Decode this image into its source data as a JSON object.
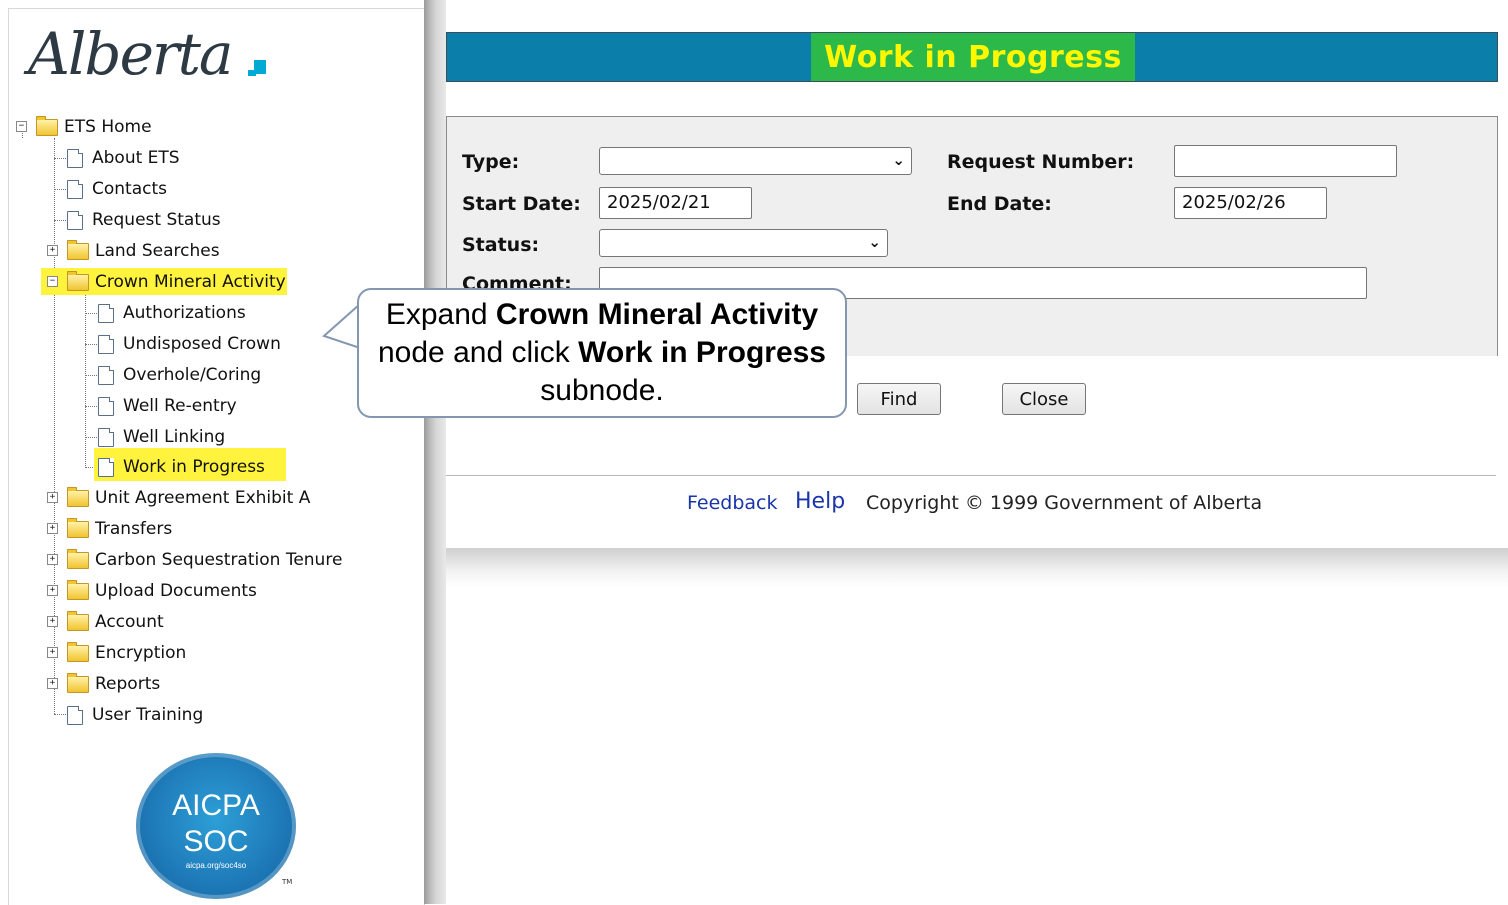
{
  "nav": {
    "logo_text": "Alberta",
    "tree": {
      "root": "ETS Home",
      "items": [
        {
          "label": "About ETS"
        },
        {
          "label": "Contacts"
        },
        {
          "label": "Request Status"
        },
        {
          "label": "Land Searches"
        },
        {
          "label": "Crown Mineral Activity"
        },
        {
          "label": "Unit Agreement Exhibit A"
        },
        {
          "label": "Transfers"
        },
        {
          "label": "Carbon Sequestration Tenure"
        },
        {
          "label": "Upload Documents"
        },
        {
          "label": "Account"
        },
        {
          "label": "Encryption"
        },
        {
          "label": "Reports"
        },
        {
          "label": "User Training"
        }
      ],
      "crown_children": [
        {
          "label": "Authorizations"
        },
        {
          "label": "Undisposed Crown"
        },
        {
          "label": "Overhole/Coring"
        },
        {
          "label": "Well Re-entry"
        },
        {
          "label": "Well Linking"
        },
        {
          "label": "Work in Progress"
        }
      ]
    },
    "badge": {
      "line1": "AICPA",
      "line2": "SOC",
      "line3": "aicpa.org/soc4so",
      "tm": "TM"
    }
  },
  "main": {
    "title": "Work in Progress",
    "form": {
      "type_label": "Type:",
      "type_value": "",
      "request_number_label": "Request Number:",
      "request_number_value": "",
      "start_date_label": "Start Date:",
      "start_date_value": "2025/02/21",
      "end_date_label": "End Date:",
      "end_date_value": "2025/02/26",
      "status_label": "Status:",
      "status_value": "",
      "comment_label": "Comment:",
      "comment_value": ""
    },
    "buttons": {
      "find": "Find",
      "close": "Close"
    },
    "footer": {
      "feedback": "Feedback",
      "help": "Help",
      "copyright": "Copyright © 1999 Government of Alberta"
    }
  },
  "callout": {
    "t1": "Expand ",
    "b1": "Crown Mineral Activity",
    "t2": " node and click ",
    "b2": "Work in Progress",
    "t3": " subnode."
  },
  "colors": {
    "title_bar": "#0b7faa",
    "title_box": "#2db84a",
    "title_text": "#fff700",
    "highlight": "#fff33d",
    "link": "#1a35a8"
  }
}
